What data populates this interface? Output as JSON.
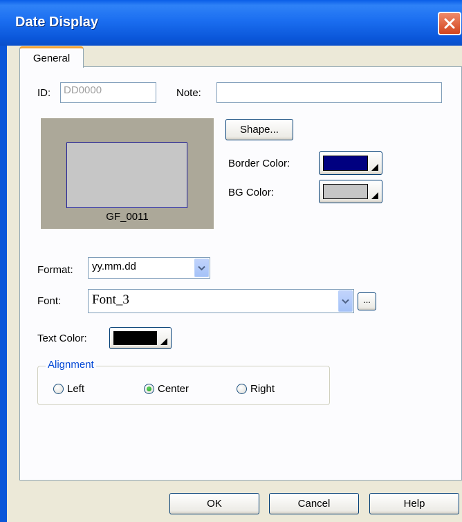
{
  "window": {
    "title": "Date Display"
  },
  "tabs": [
    {
      "label": "General"
    }
  ],
  "general": {
    "id_label": "ID:",
    "id_value": "DD0000",
    "note_label": "Note:",
    "note_value": "",
    "preview_caption": "GF_0011",
    "shape_button": "Shape...",
    "border_color_label": "Border Color:",
    "border_color": "#000080",
    "bg_color_label": "BG Color:",
    "bg_color": "#c6c6c6",
    "format_label": "Format:",
    "format_value": "yy.mm.dd",
    "font_label": "Font:",
    "font_value": "Font_3",
    "font_more_button": "...",
    "text_color_label": "Text Color:",
    "text_color": "#000000",
    "alignment": {
      "title": "Alignment",
      "options": [
        {
          "label": "Left",
          "selected": false
        },
        {
          "label": "Center",
          "selected": true
        },
        {
          "label": "Right",
          "selected": false
        }
      ]
    }
  },
  "buttons": {
    "ok": "OK",
    "cancel": "Cancel",
    "help": "Help"
  }
}
